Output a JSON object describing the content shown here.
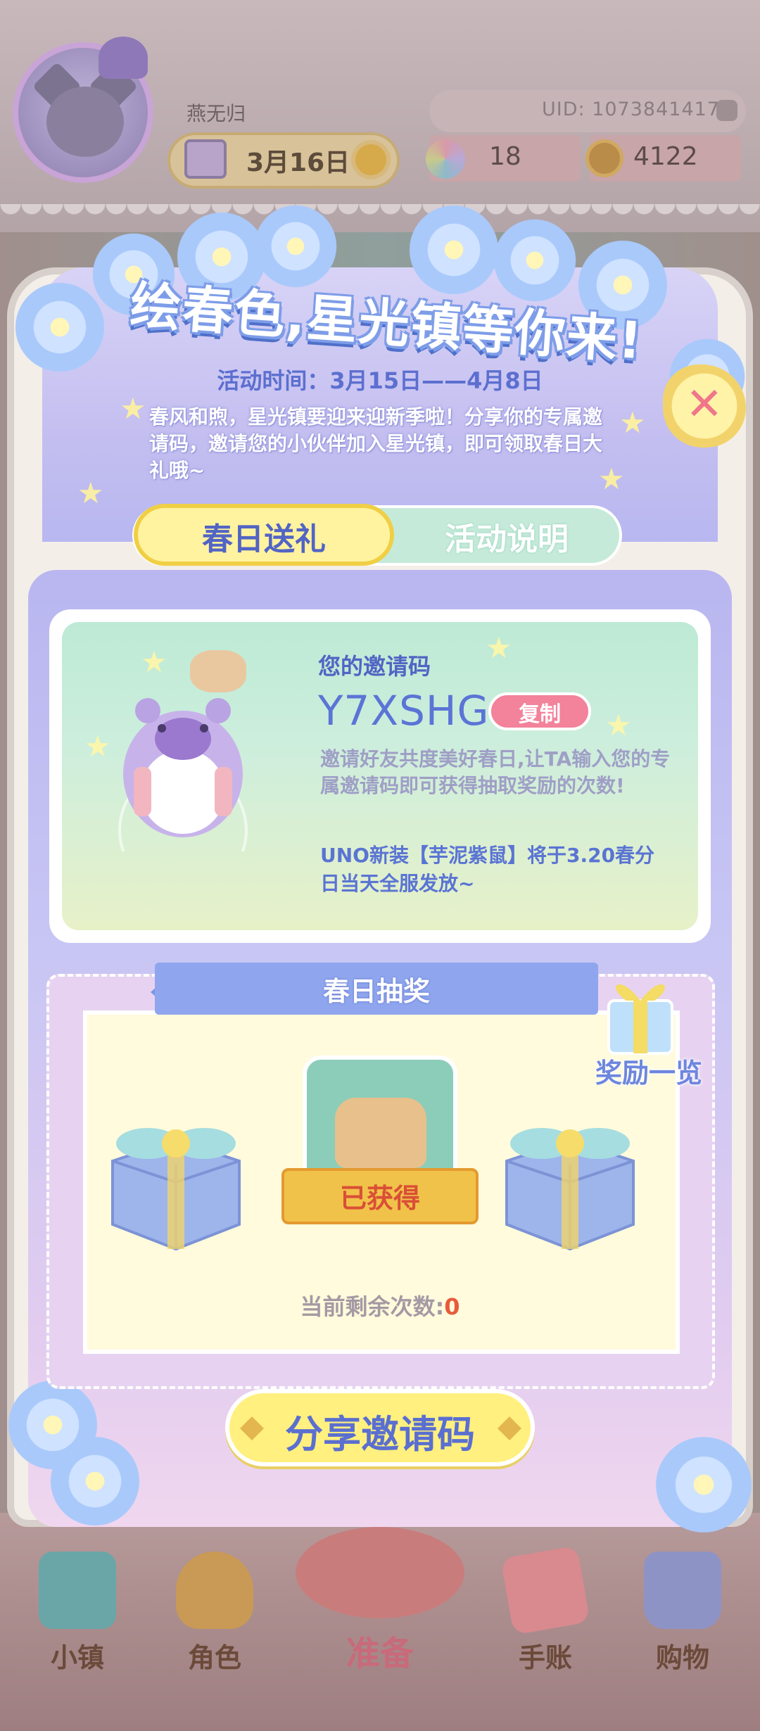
{
  "hud": {
    "player_name": "燕无归",
    "uid": "UID: 1073841417",
    "date": "3月16日",
    "gems": "18",
    "coins": "4122"
  },
  "event": {
    "title": "绘春色,星光镇等你来!",
    "time": "活动时间：3月15日——4月8日",
    "description": "春风和煦，星光镇要迎来迎新季啦！分享你的专属邀请码，邀请您的小伙伴加入星光镇，即可领取春日大礼哦~"
  },
  "tabs": [
    {
      "label": "春日送礼",
      "active": true
    },
    {
      "label": "活动说明",
      "active": false
    }
  ],
  "invite": {
    "title": "您的邀请码",
    "code": "Y7XSHG",
    "copy_label": "复制",
    "description": "邀请好友共度美好春日,让TA输入您的专属邀请码即可获得抽取奖励的次数!",
    "note": "UNO新装【芋泥紫鼠】将于3.20春分日当天全服发放~"
  },
  "draw": {
    "title": "春日抽奖",
    "reward_list_label": "奖励一览",
    "obtained_label": "已获得",
    "remaining_label": "当前剩余次数:",
    "remaining_value": "0"
  },
  "share_button": "分享邀请码",
  "nav": [
    {
      "label": "小镇",
      "icon": "map-icon"
    },
    {
      "label": "角色",
      "icon": "character-icon"
    },
    {
      "label": "准备",
      "icon": "food-basket-icon"
    },
    {
      "label": "手账",
      "icon": "journal-icon"
    },
    {
      "label": "购物",
      "icon": "shopping-bag-icon"
    }
  ],
  "colors": {
    "accent_blue": "#5a6fd0",
    "tab_active": "#fff3a0",
    "copy_button": "#f3829b",
    "remaining_value": "#e85a3d"
  }
}
